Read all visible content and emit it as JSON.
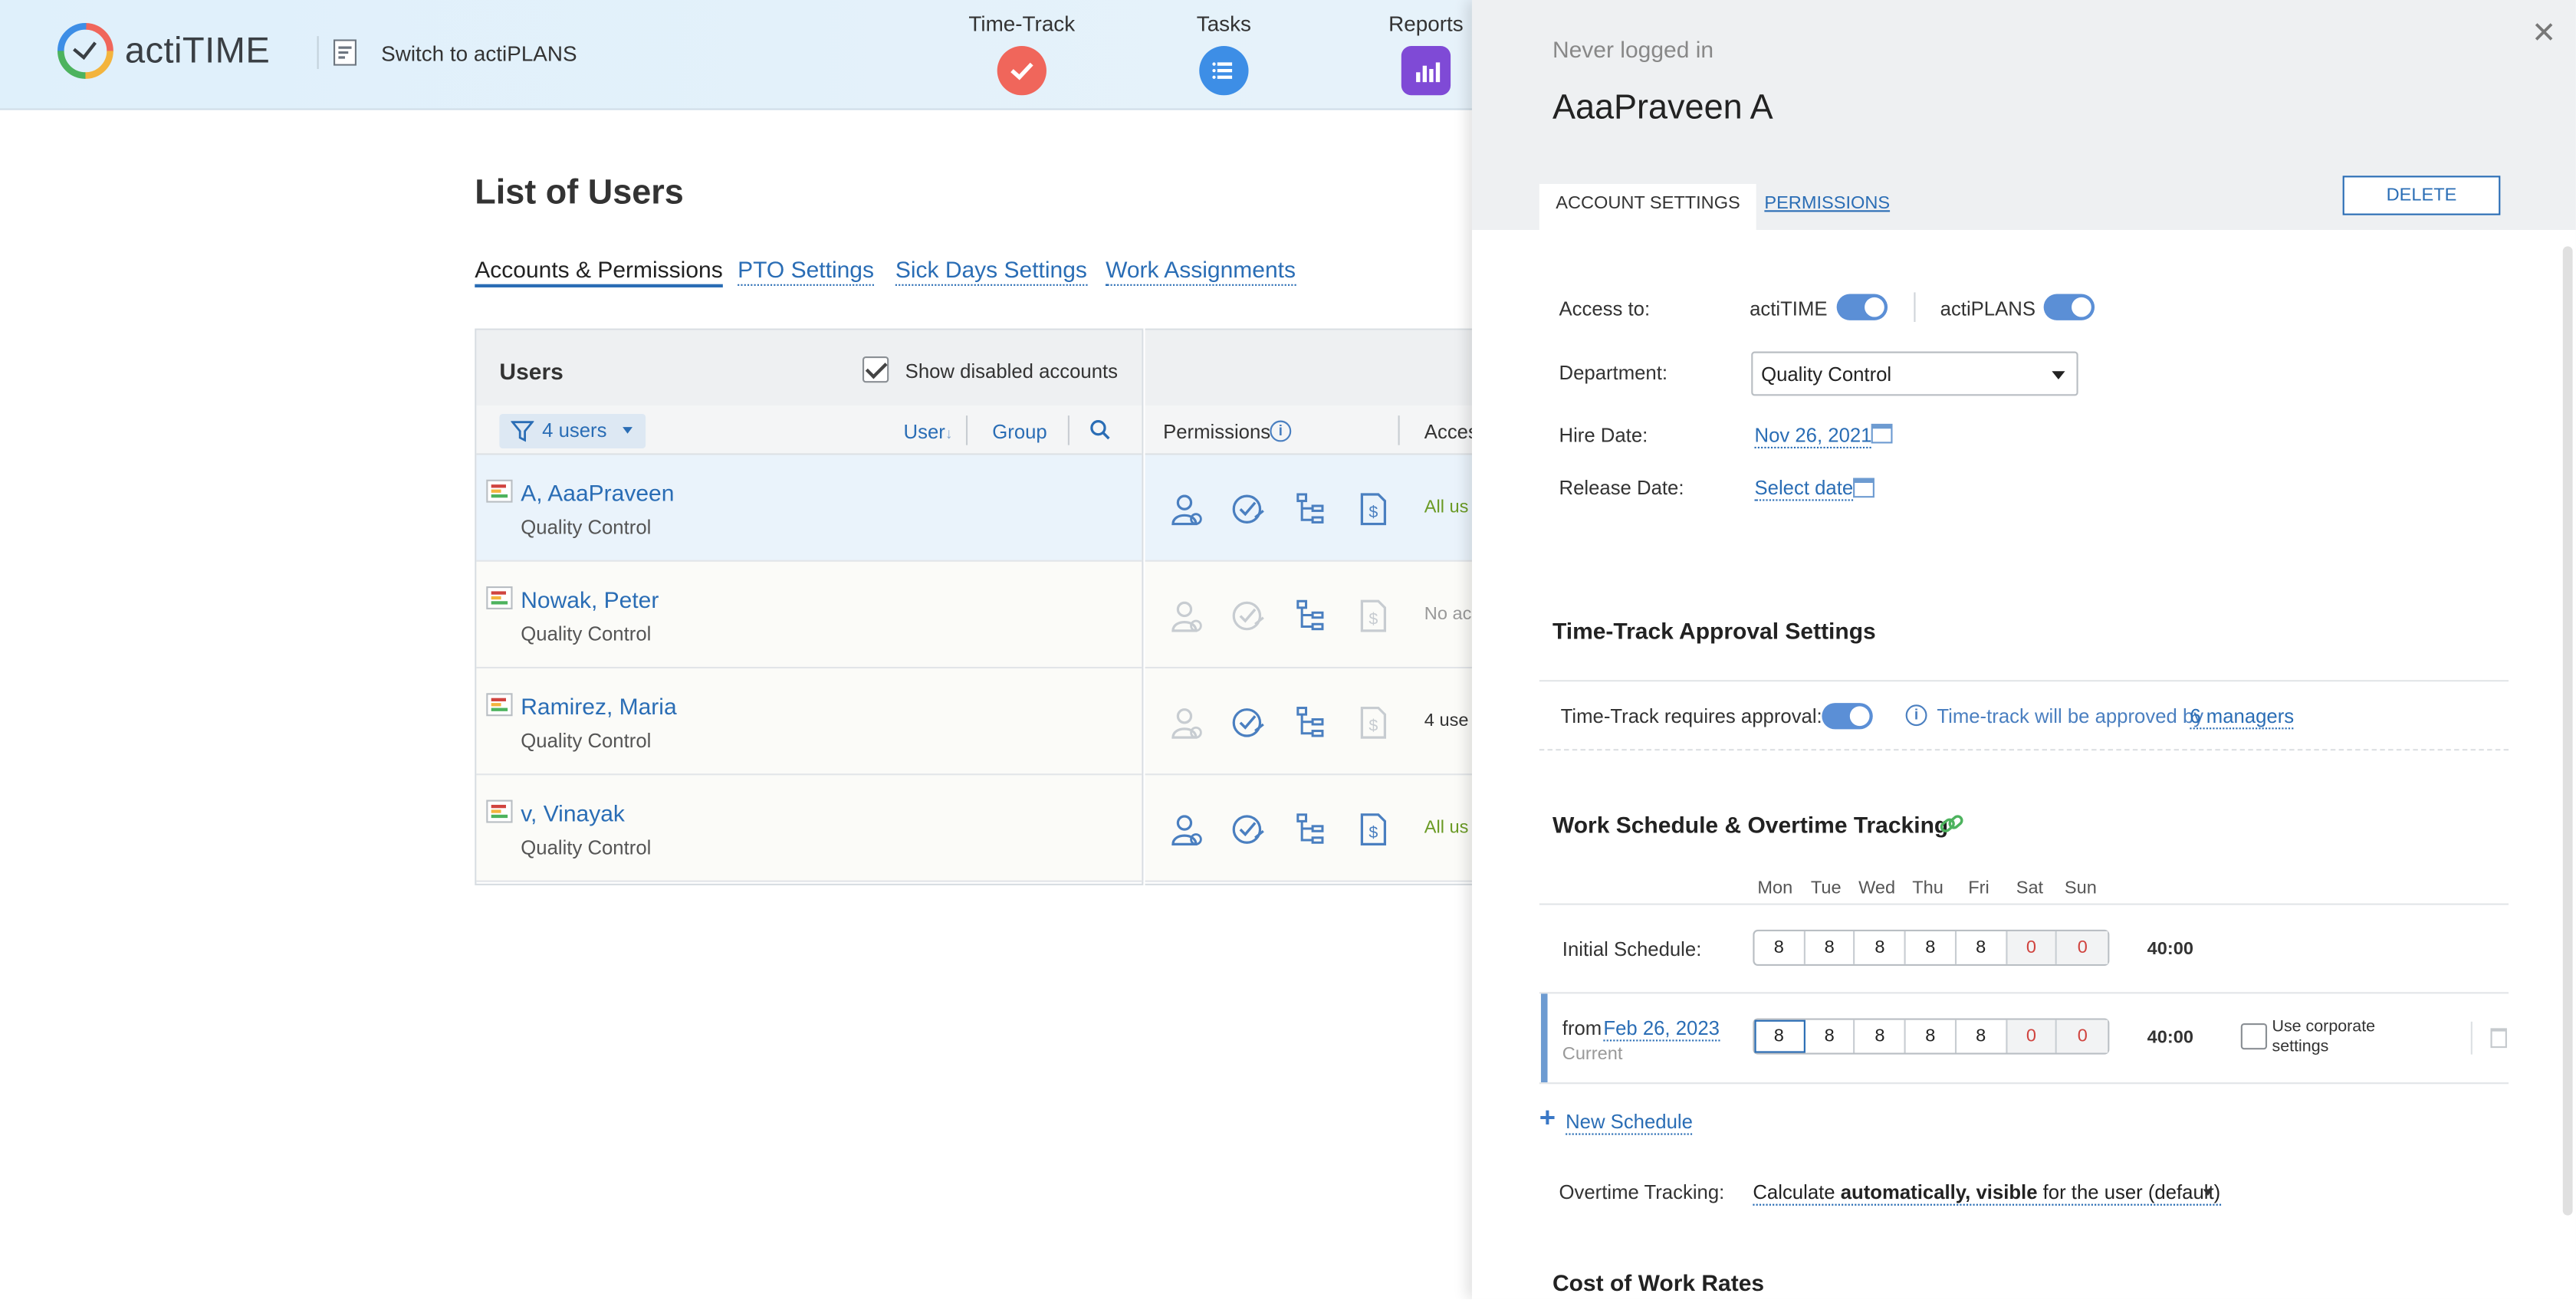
{
  "header": {
    "logo_text": "actiTIME",
    "switch_label": "Switch to actiPLANS",
    "modules": [
      {
        "label": "Time-Track",
        "color": "#f0665b"
      },
      {
        "label": "Tasks",
        "color": "#3d8ee6"
      },
      {
        "label": "Reports",
        "color": "#7f4ad6"
      }
    ]
  },
  "page": {
    "title": "List of Users",
    "tabs": [
      "Accounts & Permissions",
      "PTO Settings",
      "Sick Days Settings",
      "Work Assignments"
    ]
  },
  "users_panel": {
    "title": "Users",
    "show_disabled_label": "Show disabled accounts",
    "show_disabled_checked": true,
    "filter_label": "4 users",
    "col_user": "User",
    "col_group": "Group",
    "col_permissions": "Permissions",
    "col_access": "Acces",
    "rows": [
      {
        "name": "A, AaaPraveen",
        "dept": "Quality Control",
        "access": "All us",
        "access_color": "#6a9a24",
        "active": [
          true,
          true,
          true,
          true
        ]
      },
      {
        "name": "Nowak, Peter",
        "dept": "Quality Control",
        "access": "No ac",
        "access_color": "#999999",
        "active": [
          false,
          false,
          true,
          false
        ]
      },
      {
        "name": "Ramirez, Maria",
        "dept": "Quality Control",
        "access": "4 use",
        "access_color": "#333333",
        "active": [
          false,
          true,
          true,
          false
        ]
      },
      {
        "name": "v, Vinayak",
        "dept": "Quality Control",
        "access": "All us",
        "access_color": "#6a9a24",
        "active": [
          true,
          true,
          true,
          true
        ]
      }
    ]
  },
  "drawer": {
    "status": "Never logged in",
    "name": "AaaPraveen A",
    "tab_account": "ACCOUNT SETTINGS",
    "tab_permissions": "PERMISSIONS",
    "delete_label": "DELETE",
    "access_label": "Access to:",
    "access_actitime": "actiTIME",
    "access_actiplans": "actiPLANS",
    "department_label": "Department:",
    "department_value": "Quality Control",
    "hire_label": "Hire Date:",
    "hire_value": "Nov 26, 2021",
    "release_label": "Release Date:",
    "release_value": "Select date",
    "approval_title": "Time-Track Approval Settings",
    "approval_label": "Time-Track requires approval:",
    "approval_info": "Time-track will be approved by",
    "approval_link": "6 managers",
    "schedule_title": "Work Schedule & Overtime Tracking",
    "days": [
      "Mon",
      "Tue",
      "Wed",
      "Thu",
      "Fri",
      "Sat",
      "Sun"
    ],
    "initial_label": "Initial Schedule:",
    "initial_values": [
      "8",
      "8",
      "8",
      "8",
      "8",
      "0",
      "0"
    ],
    "initial_total": "40:00",
    "from_label": "from",
    "from_date": "Feb 26, 2023",
    "current_label": "Current",
    "current_values": [
      "8",
      "8",
      "8",
      "8",
      "8",
      "0",
      "0"
    ],
    "current_total": "40:00",
    "corporate_label_1": "Use corporate",
    "corporate_label_2": "settings",
    "new_schedule": "New Schedule",
    "overtime_label": "Overtime Tracking:",
    "overtime_pre": "Calculate ",
    "overtime_bold": "automatically, visible",
    "overtime_post": " for the user (default)",
    "cost_title": "Cost of Work Rates"
  }
}
